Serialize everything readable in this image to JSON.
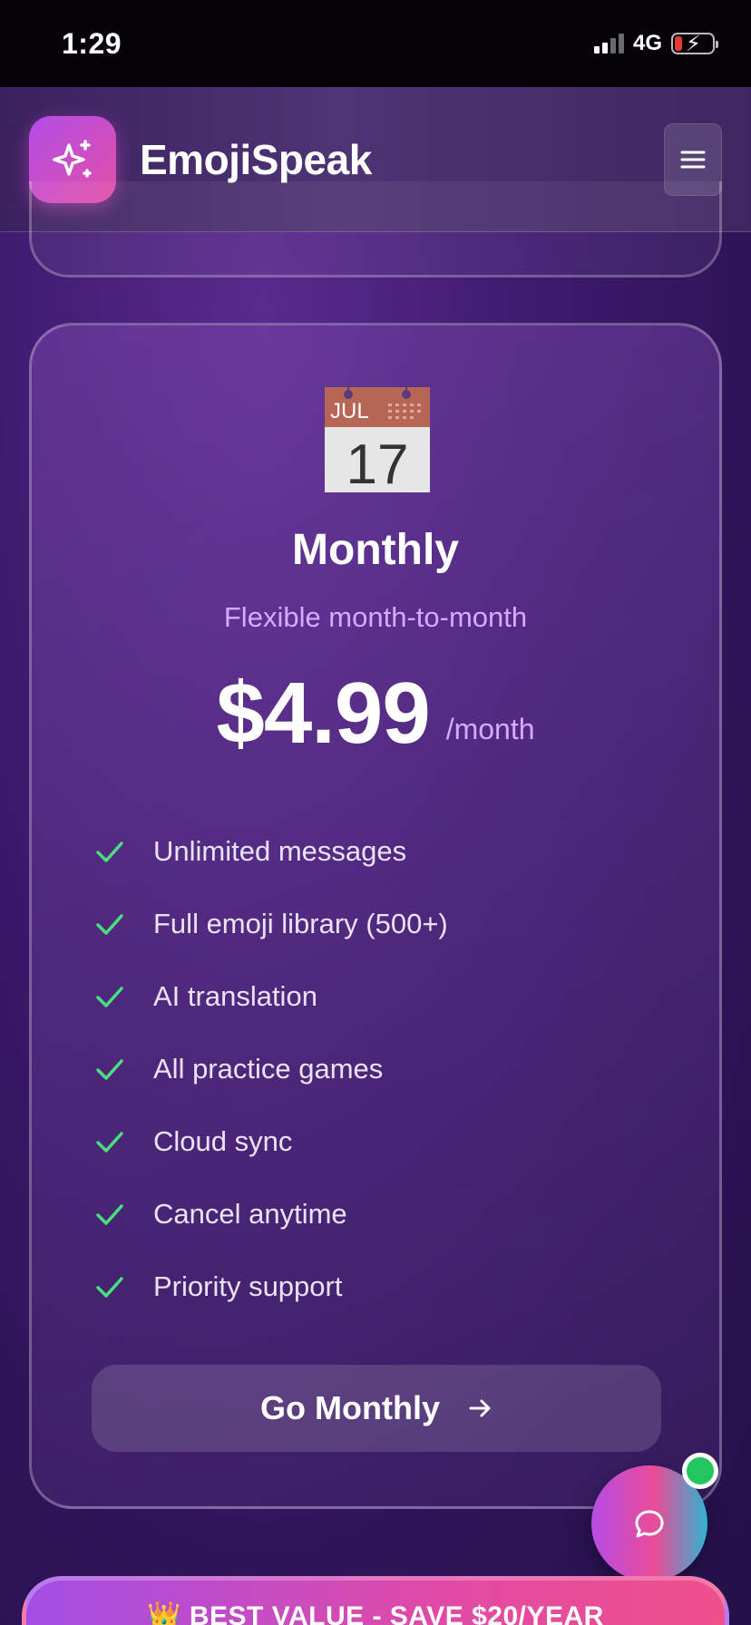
{
  "status_bar": {
    "time": "1:29",
    "network": "4G"
  },
  "header": {
    "brand": "EmojiSpeak",
    "logo_icon": "sparkles-icon",
    "menu_icon": "hamburger-icon"
  },
  "plan": {
    "icon": "calendar-icon",
    "calendar_month": "JUL",
    "calendar_day": "17",
    "title": "Monthly",
    "subtitle": "Flexible month-to-month",
    "price": "$4.99",
    "period": "/month",
    "features": [
      "Unlimited messages",
      "Full emoji library (500+)",
      "AI translation",
      "All practice games",
      "Cloud sync",
      "Cancel anytime",
      "Priority support"
    ],
    "cta_label": "Go Monthly"
  },
  "chat": {
    "icon": "chat-bubble-icon",
    "status_color": "#22c55e"
  },
  "banner": {
    "label": "👑 BEST VALUE - SAVE $20/YEAR"
  },
  "colors": {
    "accent_pink": "#e44fa6",
    "accent_purple": "#b14de8",
    "check_green": "#4ade80",
    "subtitle_lilac": "#d7a9ff"
  }
}
